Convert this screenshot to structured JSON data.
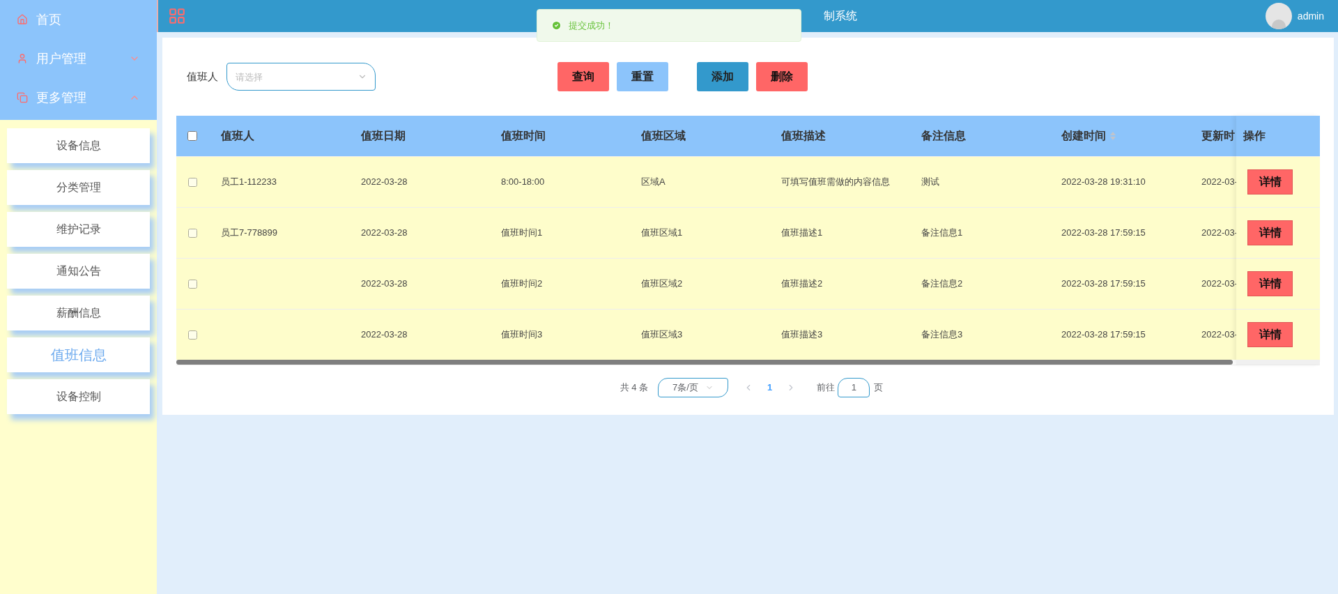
{
  "sidebar": {
    "items": [
      {
        "label": "首页"
      },
      {
        "label": "用户管理",
        "expanded": false
      },
      {
        "label": "更多管理",
        "expanded": true
      }
    ],
    "submenu": [
      {
        "label": "设备信息",
        "selected": false
      },
      {
        "label": "分类管理",
        "selected": false
      },
      {
        "label": "维护记录",
        "selected": false
      },
      {
        "label": "通知公告",
        "selected": false
      },
      {
        "label": "薪酬信息",
        "selected": false
      },
      {
        "label": "值班信息",
        "selected": true
      },
      {
        "label": "设备控制",
        "selected": false
      }
    ]
  },
  "header": {
    "title": "制系统",
    "user": "admin"
  },
  "toast": {
    "message": "提交成功！"
  },
  "filter": {
    "label": "值班人",
    "placeholder": "请选择"
  },
  "buttons": [
    {
      "label": "查询",
      "kind": "danger"
    },
    {
      "label": "重置",
      "kind": "light"
    },
    {
      "label": "添加",
      "kind": "primary"
    },
    {
      "label": "删除",
      "kind": "danger"
    }
  ],
  "table": {
    "select_all": false,
    "columns": [
      {
        "label": "值班人",
        "sortable": false
      },
      {
        "label": "值班日期",
        "sortable": false
      },
      {
        "label": "值班时间",
        "sortable": false
      },
      {
        "label": "值班区域",
        "sortable": false
      },
      {
        "label": "值班描述",
        "sortable": false
      },
      {
        "label": "备注信息",
        "sortable": false
      },
      {
        "label": "创建时间",
        "sortable": true
      },
      {
        "label": "更新时"
      }
    ],
    "action_column": "操作",
    "rows": [
      {
        "checked": false,
        "cells": [
          "员工1-112233",
          "2022-03-28",
          "8:00-18:00",
          "区域A",
          "可填写值班需做的内容信息",
          "测试",
          "2022-03-28 19:31:10",
          "2022-03-"
        ],
        "action": "详情"
      },
      {
        "checked": false,
        "cells": [
          "员工7-778899",
          "2022-03-28",
          "值班时间1",
          "值班区域1",
          "值班描述1",
          "备注信息1",
          "2022-03-28 17:59:15",
          "2022-03-"
        ],
        "action": "详情"
      },
      {
        "checked": false,
        "cells": [
          "",
          "2022-03-28",
          "值班时间2",
          "值班区域2",
          "值班描述2",
          "备注信息2",
          "2022-03-28 17:59:15",
          "2022-03-"
        ],
        "action": "详情"
      },
      {
        "checked": false,
        "cells": [
          "",
          "2022-03-28",
          "值班时间3",
          "值班区域3",
          "值班描述3",
          "备注信息3",
          "2022-03-28 17:59:15",
          "2022-03-"
        ],
        "action": "详情"
      }
    ]
  },
  "pagination": {
    "total": "共 4 条",
    "page_size": "7条/页",
    "pages": [
      {
        "label": "1",
        "selected": true
      }
    ],
    "goto_label": "前往",
    "goto_value": "1",
    "goto_suffix": "页"
  }
}
